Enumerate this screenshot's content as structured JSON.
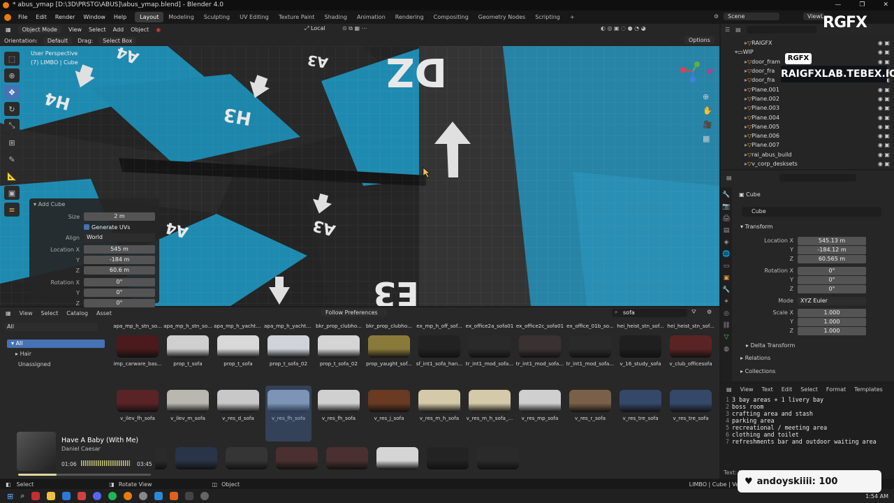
{
  "titlebar": {
    "title": "* abus_ymap [D:\\3D\\PRSTG\\ABUS]\\abus_ymap.blend] - Blender 4.0",
    "min": "—",
    "max": "❐",
    "close": "✕"
  },
  "menu": [
    "File",
    "Edit",
    "Render",
    "Window",
    "Help"
  ],
  "workspaces": [
    "Layout",
    "Modeling",
    "Sculpting",
    "UV Editing",
    "Texture Paint",
    "Shading",
    "Animation",
    "Rendering",
    "Compositing",
    "Geometry Nodes",
    "Scripting"
  ],
  "workspace_add": "+",
  "scene": "Scene",
  "view_layer": "ViewLayer",
  "viewport": {
    "mode": "Object Mode",
    "menus": [
      "View",
      "Select",
      "Add",
      "Object"
    ],
    "transform_space": "Local",
    "orientation_label": "Orientation:",
    "orientation_value": "Default",
    "drag_label": "Drag:",
    "drag_value": "Select Box",
    "options": "Options",
    "perspective": "User Perspective",
    "object_info": "(7) LIMBO | Cube",
    "floor_labels": [
      "A4",
      "A3",
      "H4",
      "H3",
      "A4",
      "A3",
      "DZ",
      "E3"
    ]
  },
  "add_cube": {
    "title": "Add Cube",
    "size_label": "Size",
    "size": "2 m",
    "uv_label": "Generate UVs",
    "align_label": "Align",
    "align": "World",
    "loc_label": "Location X",
    "loc_x": "545 m",
    "loc_y": "-184 m",
    "loc_z": "60.6 m",
    "rot_label": "Rotation X",
    "rot_x": "0°",
    "rot_y": "0°",
    "rot_z": "0°",
    "y_label": "Y",
    "z_label": "Z"
  },
  "outliner": {
    "items": [
      {
        "name": "RAIGFX",
        "indent": 2
      },
      {
        "name": "WIP",
        "indent": 1
      },
      {
        "name": "door_fram",
        "indent": 2
      },
      {
        "name": "door_fra",
        "indent": 2
      },
      {
        "name": "door_fra",
        "indent": 2
      },
      {
        "name": "Plane.001",
        "indent": 2
      },
      {
        "name": "Plane.002",
        "indent": 2
      },
      {
        "name": "Plane.003",
        "indent": 2
      },
      {
        "name": "Plane.004",
        "indent": 2
      },
      {
        "name": "Plane.005",
        "indent": 2
      },
      {
        "name": "Plane.006",
        "indent": 2
      },
      {
        "name": "Plane.007",
        "indent": 2
      },
      {
        "name": "rai_abus_build",
        "indent": 2
      },
      {
        "name": "v_corp_desksets",
        "indent": 2
      }
    ]
  },
  "properties": {
    "object_path": "Cube",
    "object_name": "Cube",
    "transform_label": "Transform",
    "location_label": "Location X",
    "loc_x": "545.13 m",
    "loc_y": "-184.12 m",
    "loc_z": "60.565 m",
    "rotation_label": "Rotation X",
    "rot_x": "0°",
    "rot_y": "0°",
    "rot_z": "0°",
    "mode_label": "Mode",
    "mode": "XYZ Euler",
    "scale_label": "Scale X",
    "scale_x": "1.000",
    "scale_y": "1.000",
    "scale_z": "1.000",
    "y_label": "Y",
    "z_label": "Z",
    "delta": "Delta Transform",
    "relations": "Relations",
    "collections": "Collections"
  },
  "text_editor": {
    "menus": [
      "View",
      "Text",
      "Edit",
      "Select",
      "Format",
      "Templates"
    ],
    "lines": [
      "3 bay areas + 1 livery bay",
      "boss room",
      "crafting area and stash",
      "parking area",
      "recreational / meeting area",
      "clothing and toilet",
      "refreshments bar and outdoor waiting area"
    ],
    "footer": "Text: I"
  },
  "asset_browser": {
    "menus": [
      "View",
      "Select",
      "Catalog",
      "Asset"
    ],
    "follow": "Follow Preferences",
    "search": "sofa",
    "filter_all": "All",
    "tree": [
      "All",
      "Hair",
      "Unassigned"
    ],
    "row0_labels": [
      "apa_mp_h_stn_so...",
      "apa_mp_h_stn_so...",
      "apa_mp_h_yacht_...",
      "apa_mp_h_yacht_...",
      "bkr_prop_clubho...",
      "bkr_prop_clubho...",
      "ex_mp_h_off_sof...",
      "ex_office2a_sofa01",
      "ex_office2c_sofa01",
      "ex_office_01b_so...",
      "hei_heist_stn_sof...",
      "hei_heist_stn_sof..."
    ],
    "row1_labels": [
      "imp_carware_bas...",
      "prop_t_sofa",
      "prop_t_sofa",
      "prop_t_sofa_02",
      "prop_t_sofa_02",
      "prop_yaught_sof...",
      "sf_int1_sofa_han...",
      "tr_int1_mod_sofa...",
      "tr_int1_mod_sofa...",
      "tr_int1_mod_sofa...",
      "v_16_study_sofa",
      "v_club_officesofa"
    ],
    "row2_labels": [
      "v_ilev_fh_sofa",
      "v_ilev_m_sofa",
      "v_res_d_sofa",
      "v_res_fh_sofa",
      "v_res_fh_sofa",
      "v_res_j_sofa",
      "v_res_m_h_sofa",
      "v_res_m_h_sofa_...",
      "v_res_mp_sofa",
      "v_res_r_sofa",
      "v_res_tre_sofa",
      "v_res_tre_sofa"
    ],
    "row1_colors": [
      "#4a1a1c",
      "#cfcfcf",
      "#d8d8d8",
      "#d0d4da",
      "#d5d5d5",
      "#8a7a3a",
      "#222222",
      "#2a2a2a",
      "#3a3232",
      "#2a2a2a",
      "#1f1f1f",
      "#5a2424"
    ],
    "row2_colors": [
      "#5a2326",
      "#b8b8b0",
      "#c8c8c8",
      "#9aa6b8",
      "#d0d0d0",
      "#6a3a22",
      "#d4c9a8",
      "#d4c9a8",
      "#cfcfcf",
      "#7a6048",
      "#35486a",
      "#35486a"
    ],
    "row3_colors": [
      "#2a2a2a",
      "#2a3448",
      "#353535",
      "#4a3030",
      "#4a3030",
      "#d5d5d5",
      "#232323",
      "#2a2a2a"
    ]
  },
  "music": {
    "title": "Have A Baby (With Me)",
    "artist": "Daniel Caesar",
    "elapsed": "01:06",
    "duration": "03:45",
    "progress": 0.29
  },
  "statusbar": {
    "select": "Select",
    "rotate": "Rotate View",
    "object": "Object",
    "info": "LIMBO | Cube | Ve"
  },
  "overlay": {
    "rgfx": "RGFX",
    "badge": "RGFX",
    "link": "RAIGFXLAB.TEBEX.IO/",
    "toast": "andoyskiiii: 100"
  },
  "clock": "1:54 AM",
  "colors": {
    "accent": "#4772b3",
    "blender_orange": "#e87d0d",
    "floor_blue": "#1f8ab0"
  }
}
